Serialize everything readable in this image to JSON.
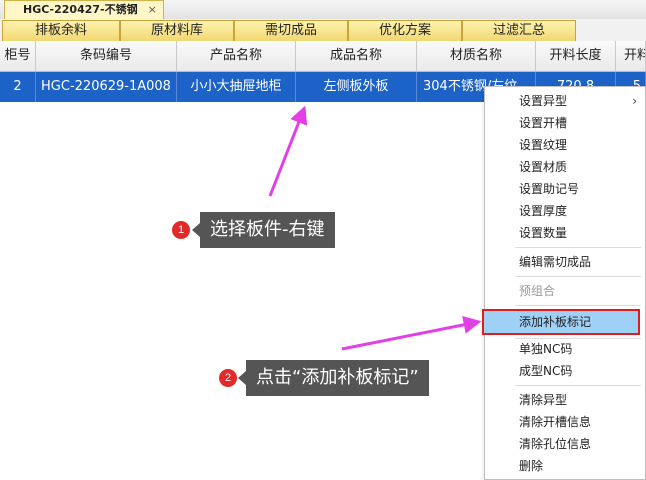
{
  "doc_tab": {
    "title": "HGC-220427-不锈钢",
    "close": "×"
  },
  "sub_tabs": [
    "排板余料",
    "原材料库",
    "需切成品",
    "优化方案",
    "过滤汇总"
  ],
  "grid": {
    "headers": [
      "柜号",
      "条码编号",
      "产品名称",
      "成品名称",
      "材质名称",
      "开料长度",
      "开料"
    ],
    "selected_row": [
      "2",
      "HGC-220629-1A008",
      "小小大抽屉地柜",
      "左侧板外板",
      "304不锈钢/左纹",
      "720.8",
      "5"
    ]
  },
  "context_menu": {
    "items": [
      {
        "label": "设置异型",
        "submenu": true
      },
      {
        "label": "设置开槽"
      },
      {
        "label": "设置纹理"
      },
      {
        "label": "设置材质"
      },
      {
        "label": "设置助记号"
      },
      {
        "label": "设置厚度"
      },
      {
        "label": "设置数量"
      },
      {
        "label": "编辑需切成品"
      },
      {
        "label": "预组合",
        "disabled": true
      },
      {
        "label": "添加补板标记",
        "highlight": true
      },
      {
        "label": "单独NC码"
      },
      {
        "label": "成型NC码"
      },
      {
        "label": "清除异型"
      },
      {
        "label": "清除开槽信息"
      },
      {
        "label": "清除孔位信息"
      },
      {
        "label": "删除"
      }
    ],
    "submenu_arrow": "›"
  },
  "annotations": {
    "step1": {
      "num": "1",
      "text": "选择板件-右键"
    },
    "step2": {
      "num": "2",
      "text": "点击“添加补板标记”"
    }
  },
  "colors": {
    "selection": "#1d63c7",
    "menu_highlight": "#9fd0f5",
    "highlight_border": "#e21b1b",
    "arrow": "#e33fe6",
    "callout_bg": "#555555",
    "badge": "#e32a2a"
  }
}
